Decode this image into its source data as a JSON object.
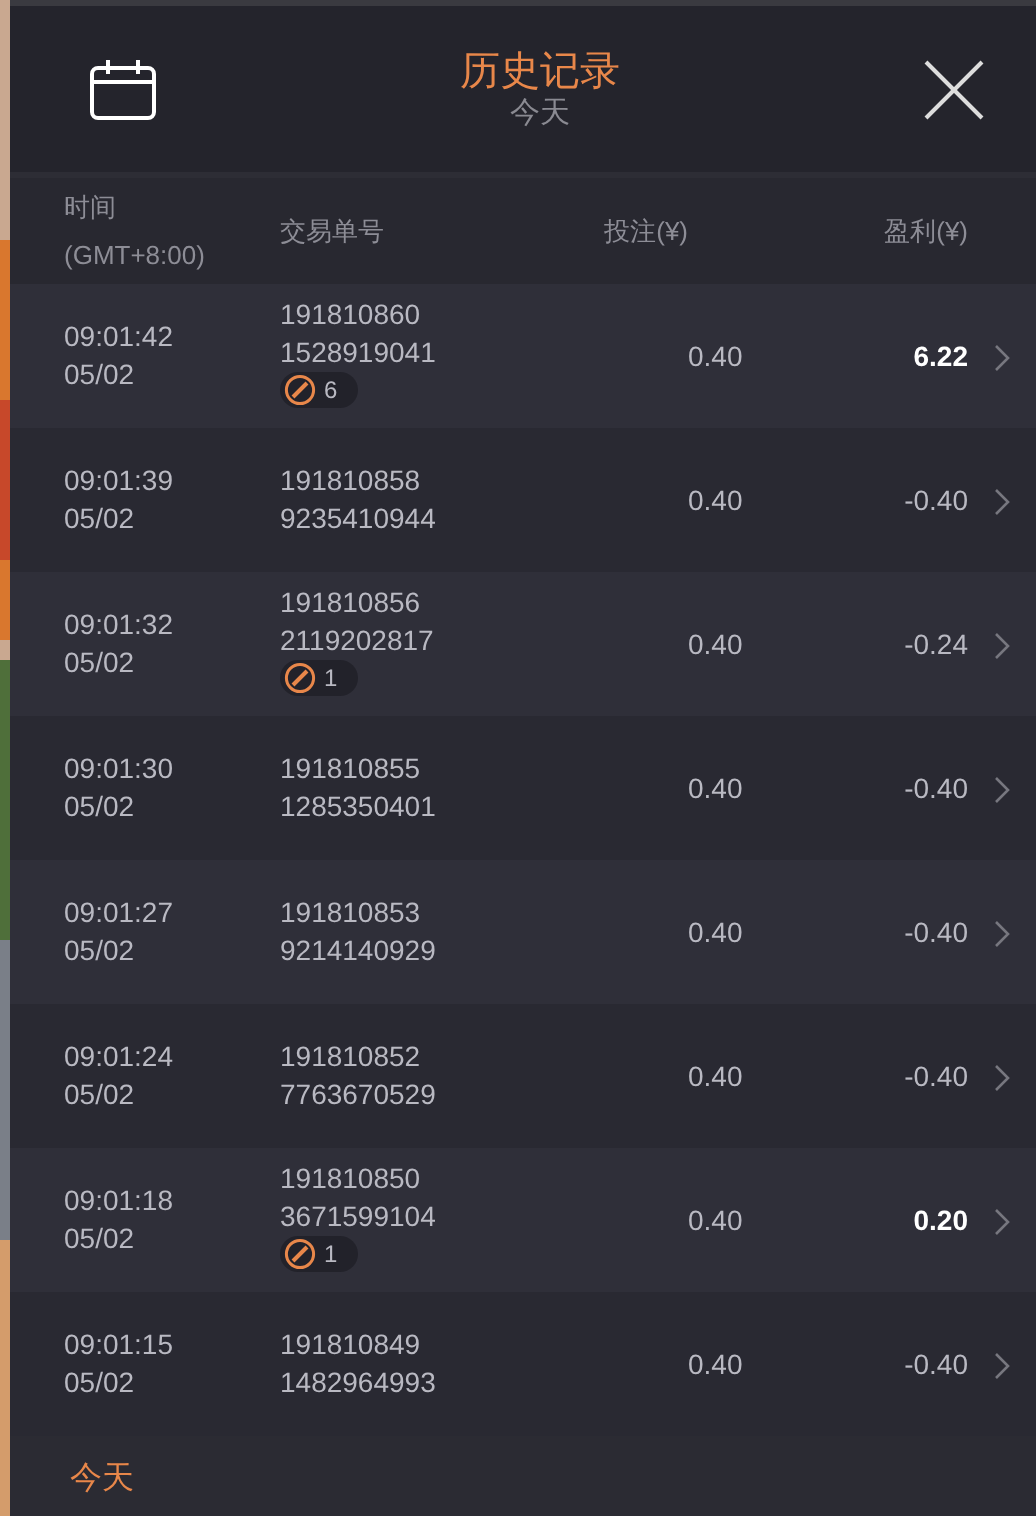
{
  "header": {
    "title": "历史记录",
    "subtitle": "今天"
  },
  "columns": [
    {
      "line1": "时间",
      "line2": "(GMT+8:00)"
    },
    {
      "line1": "交易单号"
    },
    {
      "line1": "投注(¥)"
    },
    {
      "line1": "盈利(¥)"
    }
  ],
  "rows": [
    {
      "time": "09:01:42",
      "date": "05/02",
      "id1": "191810860",
      "id2": "1528919041",
      "badge": "6",
      "stake": "0.40",
      "profit": "6.22",
      "highlight": true
    },
    {
      "time": "09:01:39",
      "date": "05/02",
      "id1": "191810858",
      "id2": "9235410944",
      "stake": "0.40",
      "profit": "-0.40",
      "highlight": false
    },
    {
      "time": "09:01:32",
      "date": "05/02",
      "id1": "191810856",
      "id2": "2119202817",
      "badge": "1",
      "stake": "0.40",
      "profit": "-0.24",
      "highlight": false
    },
    {
      "time": "09:01:30",
      "date": "05/02",
      "id1": "191810855",
      "id2": "1285350401",
      "stake": "0.40",
      "profit": "-0.40",
      "highlight": false
    },
    {
      "time": "09:01:27",
      "date": "05/02",
      "id1": "191810853",
      "id2": "9214140929",
      "stake": "0.40",
      "profit": "-0.40",
      "highlight": false
    },
    {
      "time": "09:01:24",
      "date": "05/02",
      "id1": "191810852",
      "id2": "7763670529",
      "stake": "0.40",
      "profit": "-0.40",
      "highlight": false
    },
    {
      "time": "09:01:18",
      "date": "05/02",
      "id1": "191810850",
      "id2": "3671599104",
      "badge": "1",
      "stake": "0.40",
      "profit": "0.20",
      "highlight": true
    },
    {
      "time": "09:01:15",
      "date": "05/02",
      "id1": "191810849",
      "id2": "1482964993",
      "stake": "0.40",
      "profit": "-0.40",
      "highlight": false
    }
  ],
  "footer": {
    "label": "今天"
  }
}
